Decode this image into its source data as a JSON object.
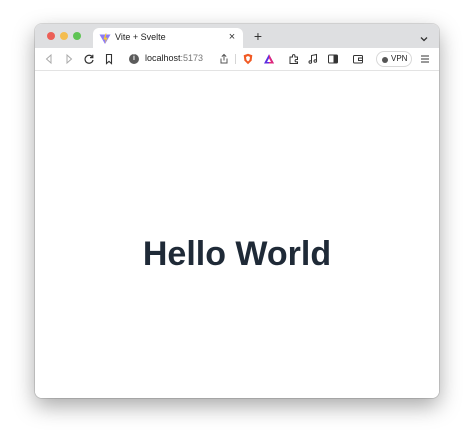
{
  "browser": {
    "tab": {
      "title": "Vite + Svelte",
      "close": "×"
    },
    "new_tab": "+",
    "url": {
      "host": "localhost",
      "port": ":5173",
      "info": "i"
    },
    "vpn_label": "VPN"
  },
  "page": {
    "heading": "Hello World"
  },
  "colors": {
    "tabstrip": "#dedfe1",
    "heading": "#1f2a37",
    "traffic_red": "#ec5f57",
    "traffic_yellow": "#f4bd4f",
    "traffic_green": "#5fc454"
  }
}
